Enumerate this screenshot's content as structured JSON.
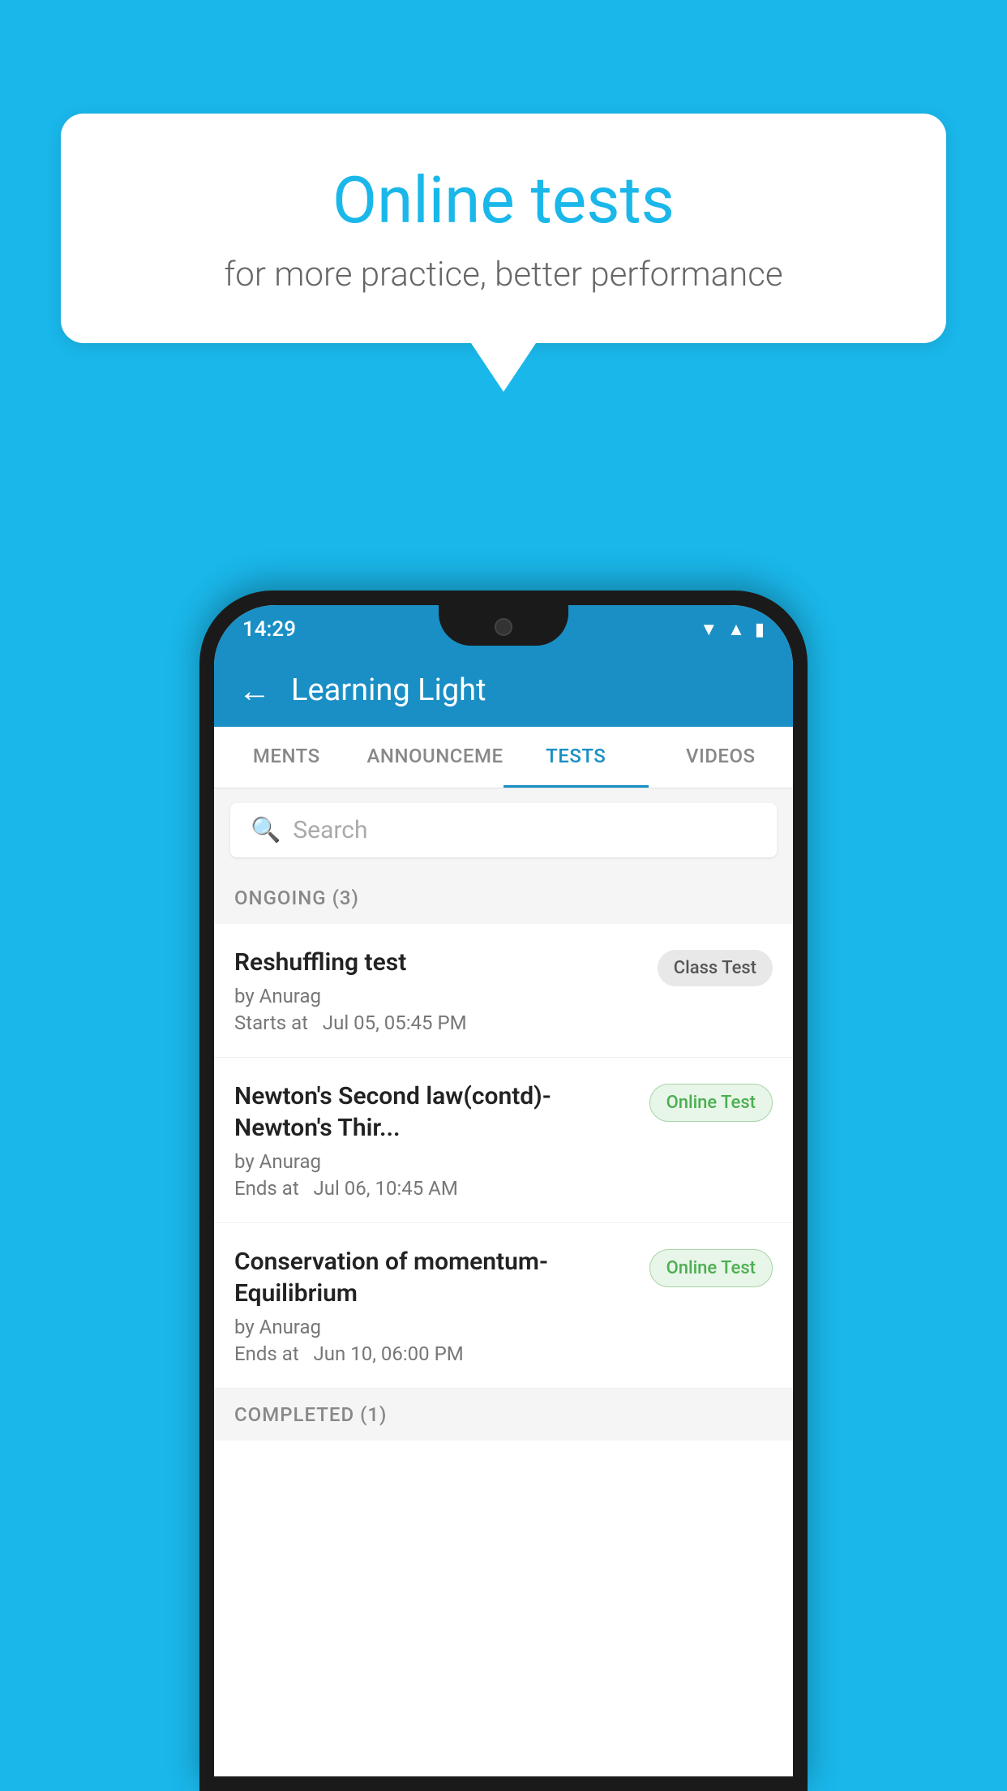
{
  "background": {
    "color": "#1ab7ea"
  },
  "speech_bubble": {
    "title": "Online tests",
    "subtitle": "for more practice, better performance"
  },
  "status_bar": {
    "time": "14:29",
    "icons": [
      "wifi",
      "signal",
      "battery"
    ]
  },
  "app_bar": {
    "title": "Learning Light",
    "back_label": "←"
  },
  "tabs": [
    {
      "label": "MENTS",
      "active": false
    },
    {
      "label": "ANNOUNCEMENTS",
      "active": false
    },
    {
      "label": "TESTS",
      "active": true
    },
    {
      "label": "VIDEOS",
      "active": false
    }
  ],
  "search": {
    "placeholder": "Search"
  },
  "ongoing_section": {
    "label": "ONGOING (3)"
  },
  "test_items": [
    {
      "name": "Reshuffling test",
      "by": "by Anurag",
      "time_label": "Starts at",
      "time": "Jul 05, 05:45 PM",
      "badge": "Class Test",
      "badge_type": "gray"
    },
    {
      "name": "Newton's Second law(contd)-Newton's Thir...",
      "by": "by Anurag",
      "time_label": "Ends at",
      "time": "Jul 06, 10:45 AM",
      "badge": "Online Test",
      "badge_type": "green"
    },
    {
      "name": "Conservation of momentum-Equilibrium",
      "by": "by Anurag",
      "time_label": "Ends at",
      "time": "Jun 10, 06:00 PM",
      "badge": "Online Test",
      "badge_type": "green"
    }
  ],
  "completed_section": {
    "label": "COMPLETED (1)"
  }
}
